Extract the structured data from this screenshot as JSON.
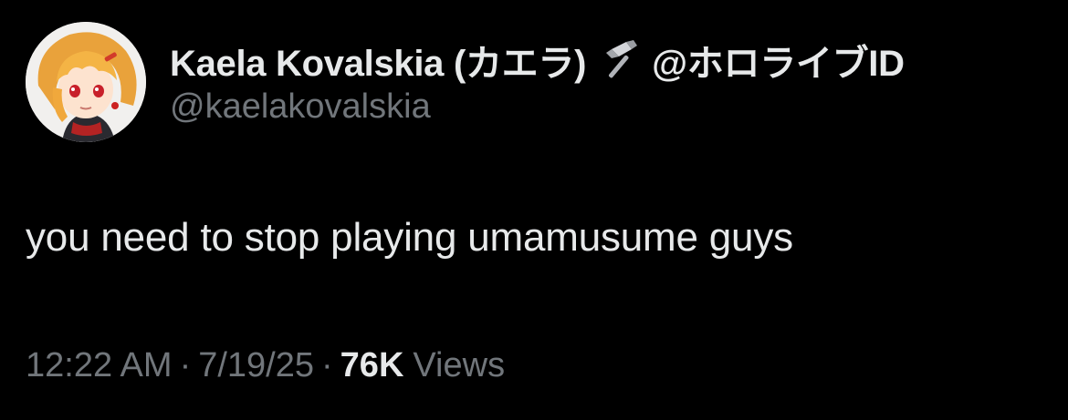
{
  "author": {
    "display_name": "Kaela Kovalskia (カエラ)",
    "name_suffix": "@ホロライブID",
    "handle": "@kaelakovalskia",
    "avatar_icon": "avatar-image",
    "emoji_icon": "hammer-icon"
  },
  "tweet": {
    "text": "you need to stop playing umamusume guys"
  },
  "meta": {
    "time": "12:22 AM",
    "separator": "·",
    "date": "7/19/25",
    "views_count": "76K",
    "views_label": "Views"
  },
  "colors": {
    "background": "#000000",
    "primary_text": "#e7e9ea",
    "secondary_text": "#71767b"
  }
}
